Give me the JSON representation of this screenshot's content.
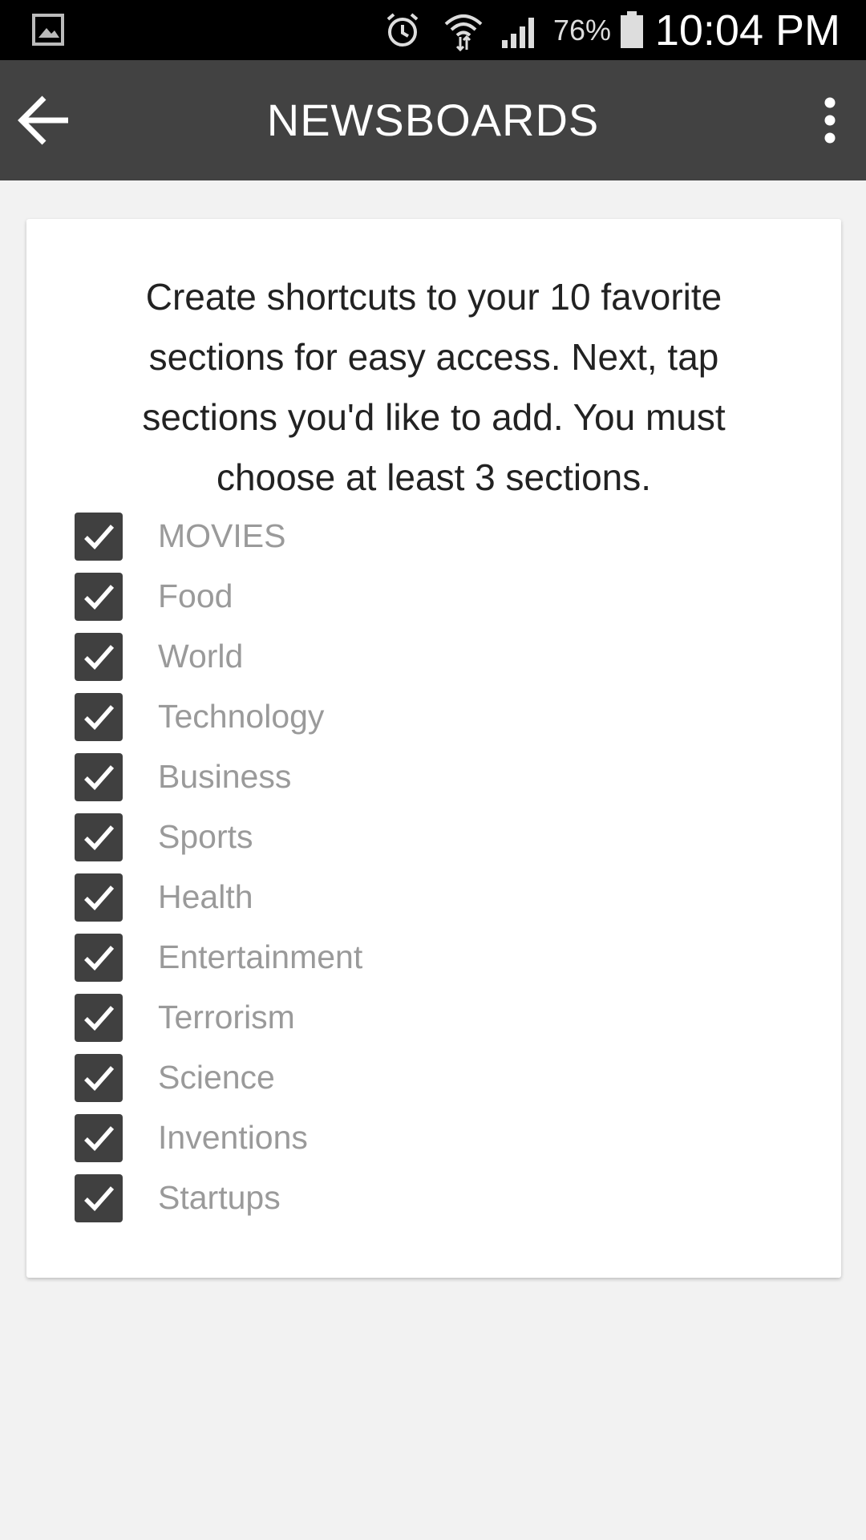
{
  "status_bar": {
    "battery_percent": "76%",
    "time": "10:04 PM",
    "icons": [
      "gallery-icon",
      "alarm-icon",
      "wifi-icon",
      "signal-icon",
      "battery-icon"
    ]
  },
  "app_bar": {
    "title": "NEWSBOARDS",
    "back_icon": "arrow-left-icon",
    "menu_icon": "more-vertical-icon"
  },
  "intro_text": "Create shortcuts to your 10 favorite sections for easy access. Next, tap sections you'd like to add. You must choose at least 3 sections.",
  "sections": [
    {
      "label": "MOVIES",
      "checked": true
    },
    {
      "label": "Food",
      "checked": true
    },
    {
      "label": "World",
      "checked": true
    },
    {
      "label": "Technology",
      "checked": true
    },
    {
      "label": "Business",
      "checked": true
    },
    {
      "label": "Sports",
      "checked": true
    },
    {
      "label": "Health",
      "checked": true
    },
    {
      "label": "Entertainment",
      "checked": true
    },
    {
      "label": "Terrorism",
      "checked": true
    },
    {
      "label": "Science",
      "checked": true
    },
    {
      "label": "Inventions",
      "checked": true
    },
    {
      "label": "Startups",
      "checked": true
    }
  ],
  "colors": {
    "app_bar": "#424242",
    "checkbox": "#404040",
    "label": "#9a9a9a",
    "background": "#f2f2f2"
  }
}
